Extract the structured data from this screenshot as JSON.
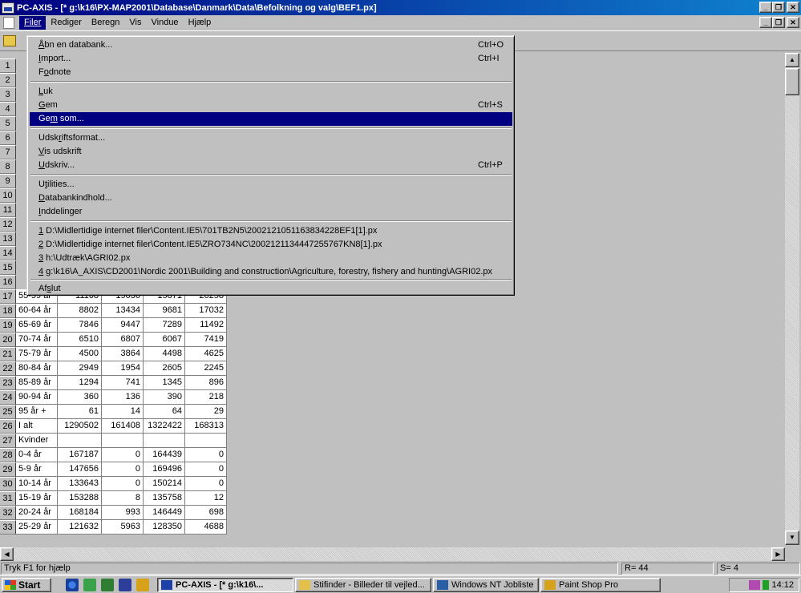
{
  "window": {
    "title": "PC-AXIS - [* g:\\k16\\PX-MAP2001\\Database\\Danmark\\Data\\Befolkning og valg\\BEF1.px]"
  },
  "menubar": {
    "items": [
      "Filer",
      "Rediger",
      "Beregn",
      "Vis",
      "Vindue",
      "Hjælp"
    ],
    "active": "Filer"
  },
  "file_menu": {
    "items": [
      {
        "label": "Åbn en databank...",
        "shortcut": "Ctrl+O"
      },
      {
        "label": "Import...",
        "shortcut": "Ctrl+I"
      },
      {
        "label": "Fodnote",
        "shortcut": ""
      },
      {
        "label": "Luk",
        "shortcut": ""
      },
      {
        "label": "Gem",
        "shortcut": "Ctrl+S"
      },
      {
        "label": "Gem som...",
        "shortcut": ""
      },
      {
        "label": "Udskriftsformat...",
        "shortcut": ""
      },
      {
        "label": "Vis udskrift",
        "shortcut": ""
      },
      {
        "label": "Udskriv...",
        "shortcut": "Ctrl+P"
      },
      {
        "label": "Utilities...",
        "shortcut": ""
      },
      {
        "label": "Databankindhold...",
        "shortcut": ""
      },
      {
        "label": "Inddelinger",
        "shortcut": ""
      },
      {
        "label": "1 D:\\Midlertidige internet filer\\Content.IE5\\701TB2N5\\2002121051163834228EF1[1].px",
        "shortcut": ""
      },
      {
        "label": "2 D:\\Midlertidige internet filer\\Content.IE5\\ZRO734NC\\2002121134447255767KN8[1].px",
        "shortcut": ""
      },
      {
        "label": "3 h:\\Udtræk\\AGRI02.px",
        "shortcut": ""
      },
      {
        "label": "4 g:\\k16\\A_AXIS\\CD2001\\Nordic 2001\\Building and construction\\Agriculture, forestry, fishery and hunting\\AGRI02.px",
        "shortcut": ""
      },
      {
        "label": "Afslut",
        "shortcut": ""
      }
    ],
    "highlighted": "Gem som..."
  },
  "grid": {
    "hidden_row_numbers": [
      "1",
      "2",
      "3",
      "4",
      "5",
      "6",
      "7",
      "8",
      "9",
      "10",
      "11",
      "12",
      "13",
      "14",
      "15",
      "16"
    ],
    "rows": [
      {
        "n": "17",
        "label": "55-59 år",
        "v": [
          "11168",
          "19036",
          "15871",
          "26258"
        ]
      },
      {
        "n": "18",
        "label": "60-64 år",
        "v": [
          "8802",
          "13434",
          "9681",
          "17032"
        ]
      },
      {
        "n": "19",
        "label": "65-69 år",
        "v": [
          "7846",
          "9447",
          "7289",
          "11492"
        ]
      },
      {
        "n": "20",
        "label": "70-74 år",
        "v": [
          "6510",
          "6807",
          "6067",
          "7419"
        ]
      },
      {
        "n": "21",
        "label": "75-79 år",
        "v": [
          "4500",
          "3864",
          "4498",
          "4625"
        ]
      },
      {
        "n": "22",
        "label": "80-84 år",
        "v": [
          "2949",
          "1954",
          "2605",
          "2245"
        ]
      },
      {
        "n": "23",
        "label": "85-89 år",
        "v": [
          "1294",
          "741",
          "1345",
          "896"
        ]
      },
      {
        "n": "24",
        "label": "90-94 år",
        "v": [
          "360",
          "136",
          "390",
          "218"
        ]
      },
      {
        "n": "25",
        "label": "95 år +",
        "v": [
          "61",
          "14",
          "64",
          "29"
        ]
      },
      {
        "n": "26",
        "label": "I alt",
        "v": [
          "1290502",
          "161408",
          "1322422",
          "168313"
        ]
      },
      {
        "n": "27",
        "label": "Kvinder",
        "v": [
          "",
          "",
          "",
          ""
        ]
      },
      {
        "n": "28",
        "label": "0-4 år",
        "v": [
          "167187",
          "0",
          "164439",
          "0"
        ]
      },
      {
        "n": "29",
        "label": "5-9 år",
        "v": [
          "147656",
          "0",
          "169496",
          "0"
        ]
      },
      {
        "n": "30",
        "label": "10-14 år",
        "v": [
          "133643",
          "0",
          "150214",
          "0"
        ]
      },
      {
        "n": "31",
        "label": "15-19 år",
        "v": [
          "153288",
          "8",
          "135758",
          "12"
        ]
      },
      {
        "n": "32",
        "label": "20-24 år",
        "v": [
          "168184",
          "993",
          "146449",
          "698"
        ]
      },
      {
        "n": "33",
        "label": "25-29 år",
        "v": [
          "121632",
          "5963",
          "128350",
          "4688"
        ]
      }
    ]
  },
  "statusbar": {
    "help": "Tryk F1 for hjælp",
    "rows": "R= 44",
    "cols": "S= 4"
  },
  "taskbar": {
    "start": "Start",
    "tasks": [
      {
        "label": "PC-AXIS - [* g:\\k16\\...",
        "pressed": true
      },
      {
        "label": "Stifinder - Billeder til vejled...",
        "pressed": false
      },
      {
        "label": "Windows NT Jobliste",
        "pressed": false
      },
      {
        "label": "Paint Shop Pro",
        "pressed": false
      }
    ],
    "clock": "14:12"
  }
}
